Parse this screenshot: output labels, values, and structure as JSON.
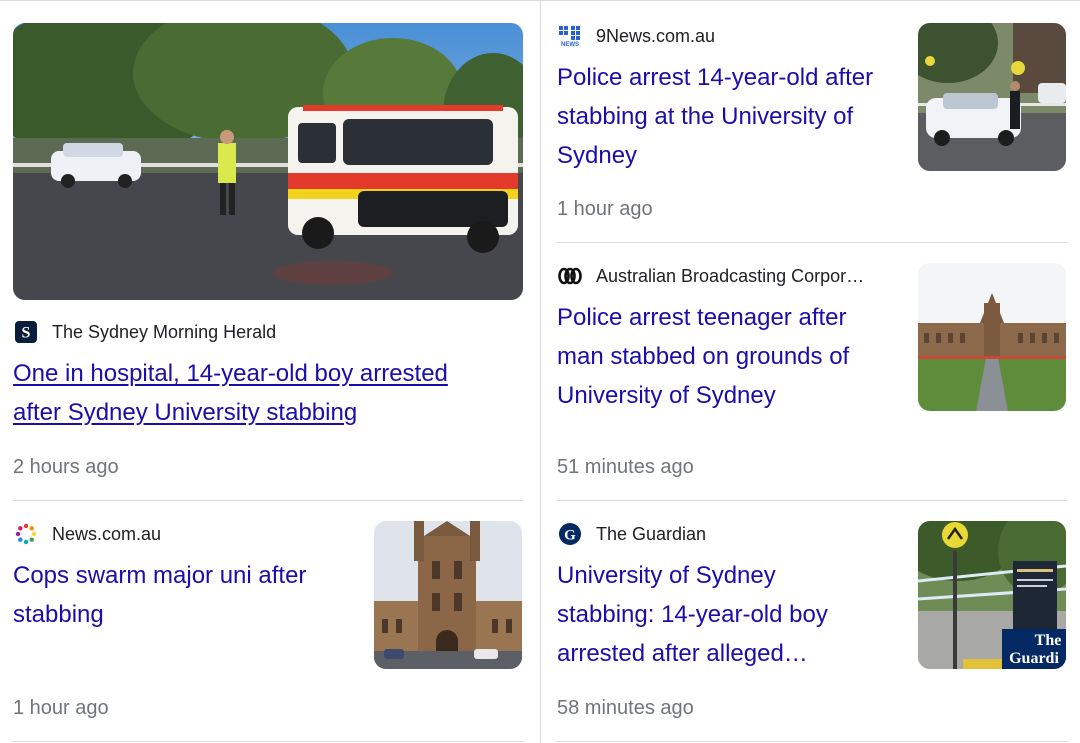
{
  "articles": [
    {
      "source": "The Sydney Morning Herald",
      "headline": "One in hospital, 14-year-old boy arrested after Sydney University stabbing",
      "time": "2 hours ago",
      "favicon_icon": "smh-s-icon",
      "thumbnail_icon": "ambulance-police-scene-image"
    },
    {
      "source": "9News.com.au",
      "headline": "Police arrest 14-year-old after stabbing at the University of Sydney",
      "time": "1 hour ago",
      "favicon_icon": "nine-news-icon",
      "thumbnail_icon": "police-car-scene-image"
    },
    {
      "source": "Australian Broadcasting Corpor…",
      "headline": "Police arrest teenager after man stabbed on grounds of University of Sydney",
      "time": "51 minutes ago",
      "favicon_icon": "abc-lissajous-icon",
      "thumbnail_icon": "university-quadrangle-image"
    },
    {
      "source": "News.com.au",
      "headline": "Cops swarm major uni after stabbing",
      "time": "1 hour ago",
      "favicon_icon": "newscomau-dots-icon",
      "thumbnail_icon": "university-tower-image"
    },
    {
      "source": "The Guardian",
      "headline": "University of Sydney stabbing: 14-year-old boy arrested after alleged…",
      "time": "58 minutes ago",
      "favicon_icon": "guardian-g-icon",
      "thumbnail_icon": "police-tape-scene-image",
      "thumbnail_watermark": "The Guardi"
    }
  ],
  "colors": {
    "link": "#1a0dab",
    "meta": "#70757a",
    "divider": "#dadce0",
    "text": "#202124"
  }
}
